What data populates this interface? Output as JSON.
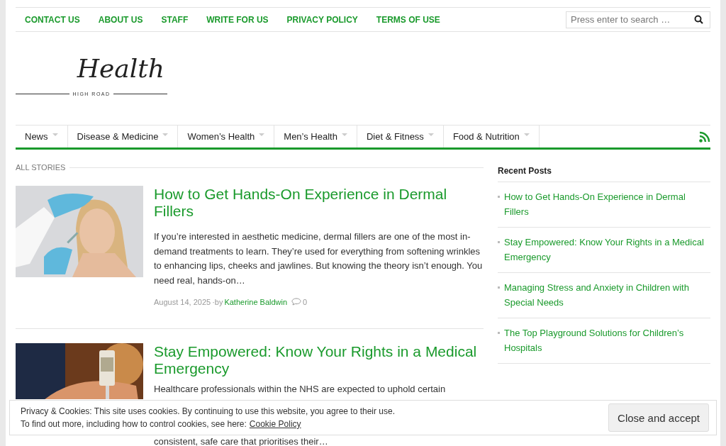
{
  "top_menu": [
    "CONTACT US",
    "ABOUT US",
    "STAFF",
    "WRITE FOR US",
    "PRIVACY POLICY",
    "TERMS OF USE"
  ],
  "search": {
    "placeholder": "Press enter to search …"
  },
  "logo": {
    "title": "Health",
    "subtitle": "HIGH ROAD"
  },
  "main_nav": [
    {
      "label": "News",
      "selected": false
    },
    {
      "label": "Disease & Medicine",
      "selected": false
    },
    {
      "label": "Women’s Health",
      "selected": false
    },
    {
      "label": "Men’s Health",
      "selected": false
    },
    {
      "label": "Diet & Fitness",
      "selected": false
    },
    {
      "label": "Food & Nutrition",
      "selected": false
    }
  ],
  "section_title": "ALL STORIES",
  "articles": [
    {
      "title": "How to Get Hands-On Experience in Dermal Fillers",
      "excerpt": "If you’re interested in aesthetic medicine, dermal fillers are one of the most in-demand treatments to learn. They’re used for everything from softening wrinkles to enhancing lips, cheeks and jawlines. But knowing the theory isn’t enough. You need real, hands-on…",
      "date": "August 14, 2025",
      "by": "·by",
      "author": "Katherine Baldwin",
      "comments": "0"
    },
    {
      "title": "Stay Empowered: Know Your Rights in a Medical Emergency",
      "excerpt_lines": [
        "Healthcare professionals within the NHS are expected to uphold certain",
        "consistent, safe care that prioritises their…"
      ]
    }
  ],
  "sidebar": {
    "title": "Recent Posts",
    "items": [
      "How to Get Hands-On Experience in Dermal Fillers",
      "Stay Empowered: Know Your Rights in a Medical Emergency",
      "Managing Stress and Anxiety in Children with Special Needs",
      "The Top Playground Solutions for Children’s Hospitals"
    ]
  },
  "cookie_banner": {
    "line1": "Privacy & Cookies: This site uses cookies. By continuing to use this website, you agree to their use.",
    "line2": "To find out more, including how to control cookies, see here:",
    "link": "Cookie Policy",
    "button": "Close and accept"
  }
}
